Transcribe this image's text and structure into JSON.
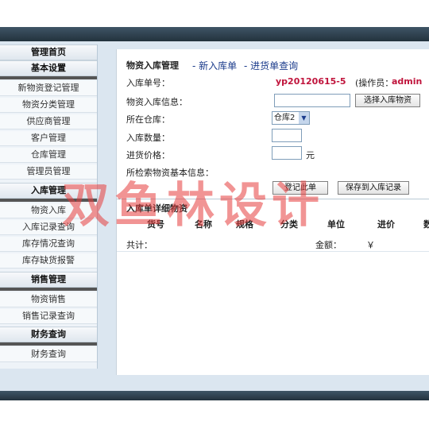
{
  "sidebar": {
    "sections": [
      {
        "title": "管理首页"
      },
      {
        "title": "基本设置"
      },
      {
        "title": "入库管理"
      },
      {
        "title": "销售管理"
      },
      {
        "title": "财务查询"
      }
    ],
    "items_basic": [
      "新物资登记管理",
      "物资分类管理",
      "供应商管理",
      "客户管理",
      "仓库管理",
      "管理员管理"
    ],
    "items_instock": [
      "物资入库",
      "入库记录查询",
      "库存情况查询",
      "库存缺货报警"
    ],
    "items_sales": [
      "物资销售",
      "销售记录查询"
    ],
    "items_finance": [
      "财务查询"
    ]
  },
  "main": {
    "title": "物资入库管理",
    "crumb1": "- 新入库单",
    "crumb2": "- 进货单查询",
    "order_label": "入库单号：",
    "order_no": "yp20120615-5",
    "operator_prefix": "(操作员：",
    "operator": "admin",
    "info_label": "物资入库信息：",
    "choose_btn": "选择入库物资",
    "warehouse_label": "所在仓库：",
    "warehouse_value": "仓库2",
    "qty_label": "入库数量：",
    "price_label": "进货价格：",
    "yuan": "元",
    "search_info_label": "所检索物资基本信息：",
    "register_btn": "登记此单",
    "save_btn": "保存到入库记录",
    "detail_title": "入库单详细物资",
    "columns": [
      "货号",
      "名称",
      "规格",
      "分类",
      "单位",
      "进价",
      "数"
    ],
    "total_label": "共计：",
    "amount_label": "金额：",
    "currency": "￥"
  },
  "watermark": "双鱼林设计"
}
